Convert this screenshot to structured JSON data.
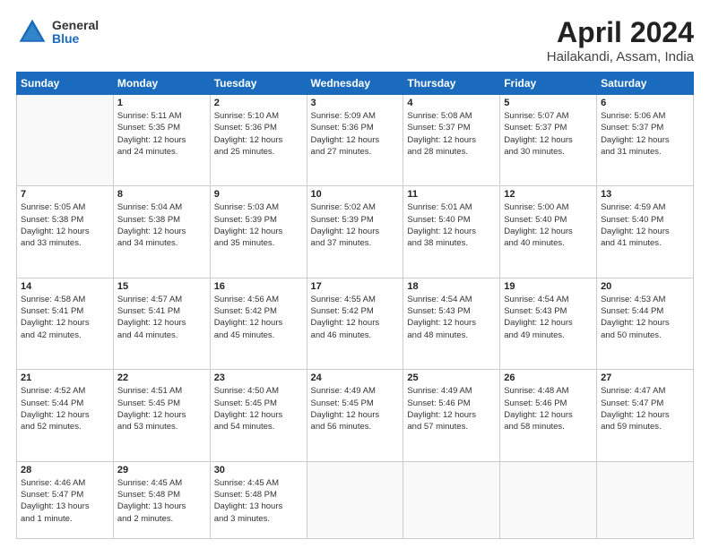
{
  "logo": {
    "general": "General",
    "blue": "Blue"
  },
  "header": {
    "title": "April 2024",
    "subtitle": "Hailakandi, Assam, India"
  },
  "columns": [
    "Sunday",
    "Monday",
    "Tuesday",
    "Wednesday",
    "Thursday",
    "Friday",
    "Saturday"
  ],
  "weeks": [
    [
      {
        "day": "",
        "info": ""
      },
      {
        "day": "1",
        "info": "Sunrise: 5:11 AM\nSunset: 5:35 PM\nDaylight: 12 hours\nand 24 minutes."
      },
      {
        "day": "2",
        "info": "Sunrise: 5:10 AM\nSunset: 5:36 PM\nDaylight: 12 hours\nand 25 minutes."
      },
      {
        "day": "3",
        "info": "Sunrise: 5:09 AM\nSunset: 5:36 PM\nDaylight: 12 hours\nand 27 minutes."
      },
      {
        "day": "4",
        "info": "Sunrise: 5:08 AM\nSunset: 5:37 PM\nDaylight: 12 hours\nand 28 minutes."
      },
      {
        "day": "5",
        "info": "Sunrise: 5:07 AM\nSunset: 5:37 PM\nDaylight: 12 hours\nand 30 minutes."
      },
      {
        "day": "6",
        "info": "Sunrise: 5:06 AM\nSunset: 5:37 PM\nDaylight: 12 hours\nand 31 minutes."
      }
    ],
    [
      {
        "day": "7",
        "info": "Sunrise: 5:05 AM\nSunset: 5:38 PM\nDaylight: 12 hours\nand 33 minutes."
      },
      {
        "day": "8",
        "info": "Sunrise: 5:04 AM\nSunset: 5:38 PM\nDaylight: 12 hours\nand 34 minutes."
      },
      {
        "day": "9",
        "info": "Sunrise: 5:03 AM\nSunset: 5:39 PM\nDaylight: 12 hours\nand 35 minutes."
      },
      {
        "day": "10",
        "info": "Sunrise: 5:02 AM\nSunset: 5:39 PM\nDaylight: 12 hours\nand 37 minutes."
      },
      {
        "day": "11",
        "info": "Sunrise: 5:01 AM\nSunset: 5:40 PM\nDaylight: 12 hours\nand 38 minutes."
      },
      {
        "day": "12",
        "info": "Sunrise: 5:00 AM\nSunset: 5:40 PM\nDaylight: 12 hours\nand 40 minutes."
      },
      {
        "day": "13",
        "info": "Sunrise: 4:59 AM\nSunset: 5:40 PM\nDaylight: 12 hours\nand 41 minutes."
      }
    ],
    [
      {
        "day": "14",
        "info": "Sunrise: 4:58 AM\nSunset: 5:41 PM\nDaylight: 12 hours\nand 42 minutes."
      },
      {
        "day": "15",
        "info": "Sunrise: 4:57 AM\nSunset: 5:41 PM\nDaylight: 12 hours\nand 44 minutes."
      },
      {
        "day": "16",
        "info": "Sunrise: 4:56 AM\nSunset: 5:42 PM\nDaylight: 12 hours\nand 45 minutes."
      },
      {
        "day": "17",
        "info": "Sunrise: 4:55 AM\nSunset: 5:42 PM\nDaylight: 12 hours\nand 46 minutes."
      },
      {
        "day": "18",
        "info": "Sunrise: 4:54 AM\nSunset: 5:43 PM\nDaylight: 12 hours\nand 48 minutes."
      },
      {
        "day": "19",
        "info": "Sunrise: 4:54 AM\nSunset: 5:43 PM\nDaylight: 12 hours\nand 49 minutes."
      },
      {
        "day": "20",
        "info": "Sunrise: 4:53 AM\nSunset: 5:44 PM\nDaylight: 12 hours\nand 50 minutes."
      }
    ],
    [
      {
        "day": "21",
        "info": "Sunrise: 4:52 AM\nSunset: 5:44 PM\nDaylight: 12 hours\nand 52 minutes."
      },
      {
        "day": "22",
        "info": "Sunrise: 4:51 AM\nSunset: 5:45 PM\nDaylight: 12 hours\nand 53 minutes."
      },
      {
        "day": "23",
        "info": "Sunrise: 4:50 AM\nSunset: 5:45 PM\nDaylight: 12 hours\nand 54 minutes."
      },
      {
        "day": "24",
        "info": "Sunrise: 4:49 AM\nSunset: 5:45 PM\nDaylight: 12 hours\nand 56 minutes."
      },
      {
        "day": "25",
        "info": "Sunrise: 4:49 AM\nSunset: 5:46 PM\nDaylight: 12 hours\nand 57 minutes."
      },
      {
        "day": "26",
        "info": "Sunrise: 4:48 AM\nSunset: 5:46 PM\nDaylight: 12 hours\nand 58 minutes."
      },
      {
        "day": "27",
        "info": "Sunrise: 4:47 AM\nSunset: 5:47 PM\nDaylight: 12 hours\nand 59 minutes."
      }
    ],
    [
      {
        "day": "28",
        "info": "Sunrise: 4:46 AM\nSunset: 5:47 PM\nDaylight: 13 hours\nand 1 minute."
      },
      {
        "day": "29",
        "info": "Sunrise: 4:45 AM\nSunset: 5:48 PM\nDaylight: 13 hours\nand 2 minutes."
      },
      {
        "day": "30",
        "info": "Sunrise: 4:45 AM\nSunset: 5:48 PM\nDaylight: 13 hours\nand 3 minutes."
      },
      {
        "day": "",
        "info": ""
      },
      {
        "day": "",
        "info": ""
      },
      {
        "day": "",
        "info": ""
      },
      {
        "day": "",
        "info": ""
      }
    ]
  ]
}
